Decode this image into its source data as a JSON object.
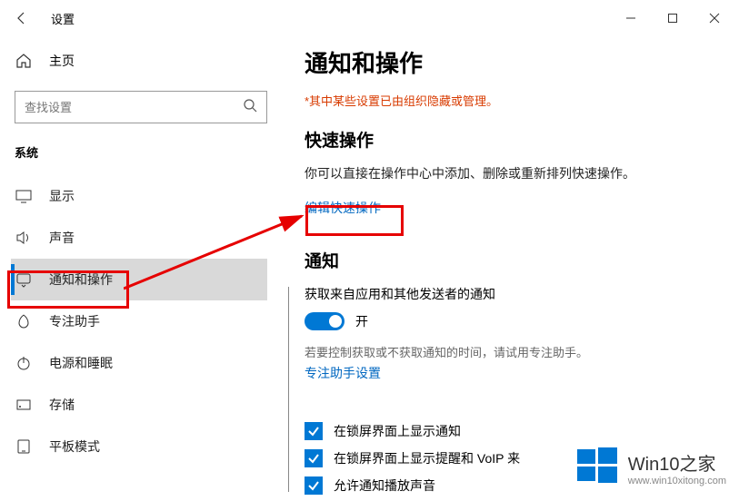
{
  "window": {
    "title": "设置"
  },
  "sidebar": {
    "home": "主页",
    "search_placeholder": "查找设置",
    "category": "系统",
    "items": [
      {
        "label": "显示"
      },
      {
        "label": "声音"
      },
      {
        "label": "通知和操作"
      },
      {
        "label": "专注助手"
      },
      {
        "label": "电源和睡眠"
      },
      {
        "label": "存储"
      },
      {
        "label": "平板模式"
      }
    ]
  },
  "content": {
    "title": "通知和操作",
    "warning": "*其中某些设置已由组织隐藏或管理。",
    "quick_ops_heading": "快速操作",
    "quick_ops_desc": "你可以直接在操作中心中添加、删除或重新排列快速操作。",
    "edit_link": "编辑快速操作",
    "notify_heading": "通知",
    "notify_sub": "获取来自应用和其他发送者的通知",
    "toggle_on": "开",
    "focus_hint": "若要控制获取或不获取通知的时间，请试用专注助手。",
    "focus_link": "专注助手设置",
    "checks": [
      "在锁屏界面上显示通知",
      "在锁屏界面上显示提醒和 VoIP 来",
      "允许通知播放声音"
    ]
  },
  "watermark": {
    "brand": "Win10之家",
    "url": "www.win10xitong.com"
  }
}
